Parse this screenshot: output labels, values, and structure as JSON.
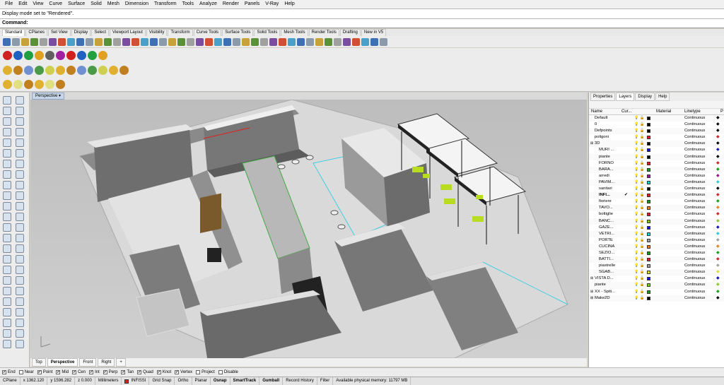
{
  "menu": [
    "File",
    "Edit",
    "View",
    "Curve",
    "Surface",
    "Solid",
    "Mesh",
    "Dimension",
    "Transform",
    "Tools",
    "Analyze",
    "Render",
    "Panels",
    "V-Ray",
    "Help"
  ],
  "command_history": "Display mode set to \"Rendered\".",
  "command_prompt": "Command:",
  "toolbar_tabs": [
    "Standard",
    "CPlanes",
    "Set View",
    "Display",
    "Select",
    "Viewport Layout",
    "Visibility",
    "Transform",
    "Curve Tools",
    "Surface Tools",
    "Solid Tools",
    "Mesh Tools",
    "Render Tools",
    "Drafting",
    "New in V5"
  ],
  "active_toolbar_tab": "Standard",
  "viewport": {
    "label": "Perspective"
  },
  "viewport_tabs": [
    "Top",
    "Perspective",
    "Front",
    "Right"
  ],
  "active_viewport_tab": "Perspective",
  "panel": {
    "tabs": [
      "Properties",
      "Layers",
      "Display",
      "Help"
    ],
    "active_tab": "Layers",
    "columns": {
      "name": "Name",
      "current": "Cur...",
      "material": "Material",
      "linetype": "Linetype",
      "print": "P"
    },
    "layers": [
      {
        "name": "Default",
        "color": "#000000",
        "linetype": "Continuous"
      },
      {
        "name": "0",
        "color": "#000000",
        "linetype": "Continuous"
      },
      {
        "name": "Defpoints",
        "color": "#000000",
        "linetype": "Continuous"
      },
      {
        "name": "poligoni",
        "color": "#e02020",
        "linetype": "Continuous"
      },
      {
        "name": "3D",
        "color": "#000000",
        "linetype": "Continuous"
      },
      {
        "name": "MURI ...",
        "color": "#1010d0",
        "linetype": "Continuous"
      },
      {
        "name": "piante",
        "color": "#000000",
        "linetype": "Continuous"
      },
      {
        "name": "FORNO",
        "color": "#e02020",
        "linetype": "Continuous"
      },
      {
        "name": "BARA...",
        "color": "#10a010",
        "linetype": "Continuous"
      },
      {
        "name": "arredi",
        "color": "#a010a0",
        "linetype": "Continuous"
      },
      {
        "name": "PAVIM...",
        "color": "#20d0e0",
        "linetype": "Continuous"
      },
      {
        "name": "sanitari",
        "color": "#000000",
        "linetype": "Continuous"
      },
      {
        "name": "INFI...",
        "color": "#e02020",
        "linetype": "Continuous",
        "current": true
      },
      {
        "name": "fioriere",
        "color": "#10a010",
        "linetype": "Continuous"
      },
      {
        "name": "TAVO...",
        "color": "#f08020",
        "linetype": "Continuous"
      },
      {
        "name": "bottiglie",
        "color": "#e02020",
        "linetype": "Continuous"
      },
      {
        "name": "BANC...",
        "color": "#80d020",
        "linetype": "Continuous"
      },
      {
        "name": "GAZE...",
        "color": "#1010d0",
        "linetype": "Continuous"
      },
      {
        "name": "VETRI...",
        "color": "#20d0e0",
        "linetype": "Continuous"
      },
      {
        "name": "PORTE",
        "color": "#a0a0a0",
        "linetype": "Continuous"
      },
      {
        "name": "CUCINA",
        "color": "#f08020",
        "linetype": "Continuous"
      },
      {
        "name": "SEZIO...",
        "color": "#10a010",
        "linetype": "Continuous"
      },
      {
        "name": "BATTI...",
        "color": "#e02020",
        "linetype": "Continuous"
      },
      {
        "name": "piastrelle",
        "color": "#a0a0a0",
        "linetype": "Continuous"
      },
      {
        "name": "SGAB...",
        "color": "#e0e020",
        "linetype": "Continuous"
      },
      {
        "name": "VISTA D...",
        "color": "#1010d0",
        "linetype": "Continuous"
      },
      {
        "name": "piante",
        "color": "#80d020",
        "linetype": "Continuous"
      },
      {
        "name": "XX - Spiti...",
        "color": "#10a010",
        "linetype": "Continuous"
      },
      {
        "name": "Make2D",
        "color": "#000000",
        "linetype": "Continuous"
      }
    ]
  },
  "osnaps": [
    {
      "label": "End",
      "checked": true
    },
    {
      "label": "Near",
      "checked": false
    },
    {
      "label": "Point",
      "checked": true
    },
    {
      "label": "Mid",
      "checked": true
    },
    {
      "label": "Cen",
      "checked": true
    },
    {
      "label": "Int",
      "checked": true
    },
    {
      "label": "Perp",
      "checked": true
    },
    {
      "label": "Tan",
      "checked": true
    },
    {
      "label": "Quad",
      "checked": true
    },
    {
      "label": "Knot",
      "checked": true
    },
    {
      "label": "Vertex",
      "checked": true
    },
    {
      "label": "Project",
      "checked": false
    },
    {
      "label": "Disable",
      "checked": false
    }
  ],
  "status": {
    "cplane": "CPlane",
    "x": "x 1362.120",
    "y": "y 1596.282",
    "z": "z 0.000",
    "units": "Millimeters",
    "current_layer": "INFISSI",
    "layer_color": "#e02020",
    "toggles": [
      "Grid Snap",
      "Ortho",
      "Planar",
      "Osnap",
      "SmartTrack",
      "Gumball",
      "Record History",
      "Filter"
    ],
    "bold_toggles": [
      "Osnap",
      "SmartTrack",
      "Gumball"
    ],
    "memory": "Available physical memory: 11797 MB"
  }
}
